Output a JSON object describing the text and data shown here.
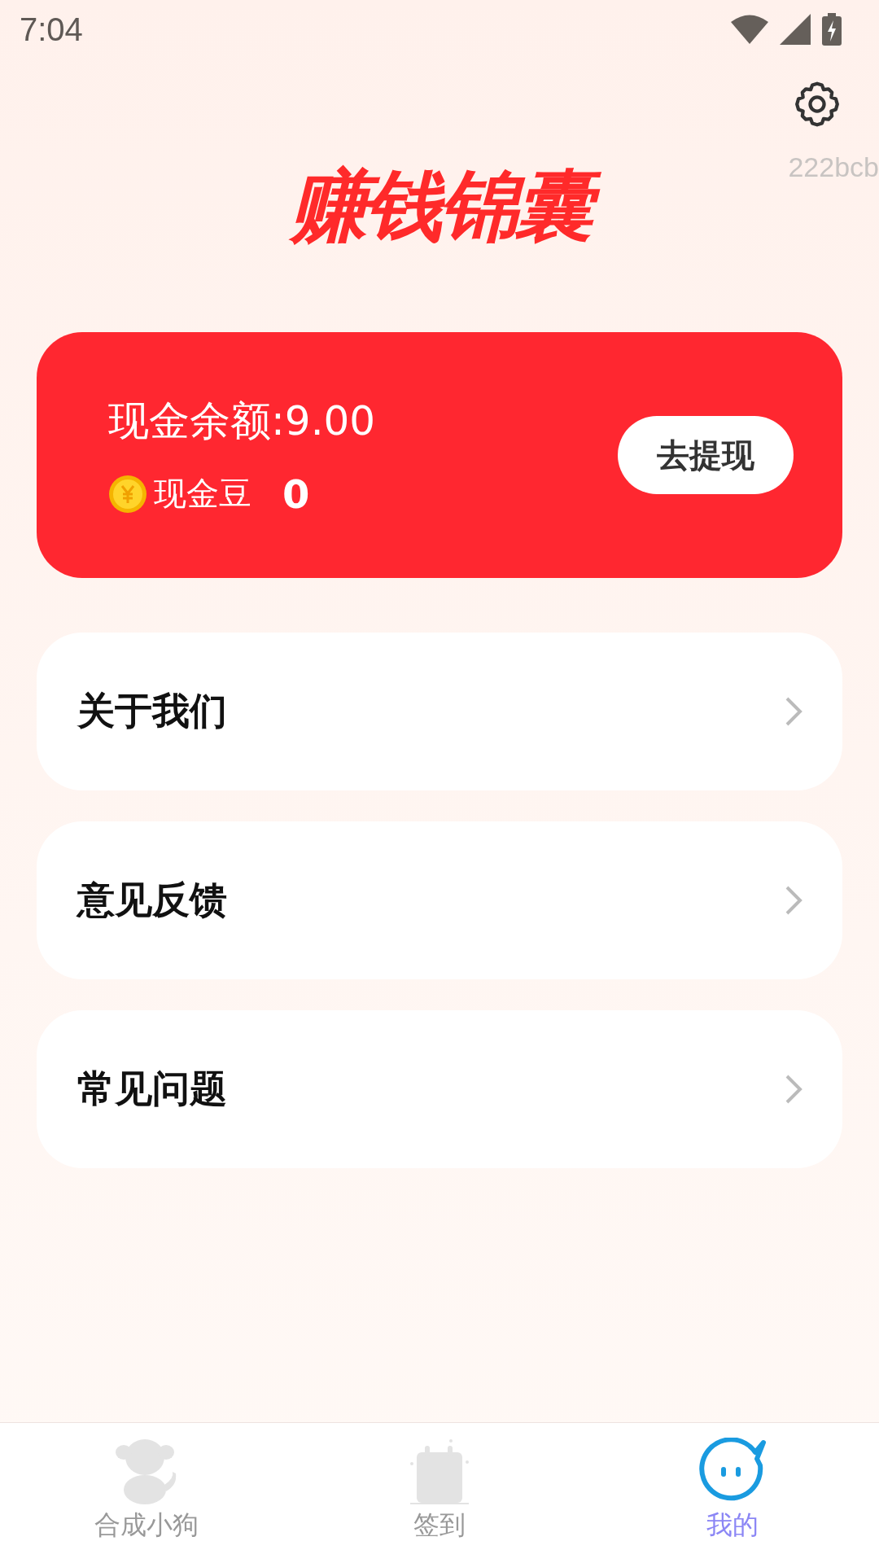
{
  "status_bar": {
    "time": "7:04"
  },
  "header": {
    "title": "赚钱锦囊",
    "code": "222bcb"
  },
  "balance_card": {
    "balance": "现金余额:9.00",
    "beans_label": "现金豆",
    "beans": "0",
    "withdraw_button": "去提现"
  },
  "menu": [
    {
      "label": "关于我们"
    },
    {
      "label": "意见反馈"
    },
    {
      "label": "常见问题"
    }
  ],
  "bottom_nav": [
    {
      "label": "合成小狗",
      "kind": "dog",
      "selected": false
    },
    {
      "label": "签到",
      "kind": "calendar",
      "selected": false
    },
    {
      "label": "我的",
      "kind": "face",
      "selected": true
    }
  ]
}
